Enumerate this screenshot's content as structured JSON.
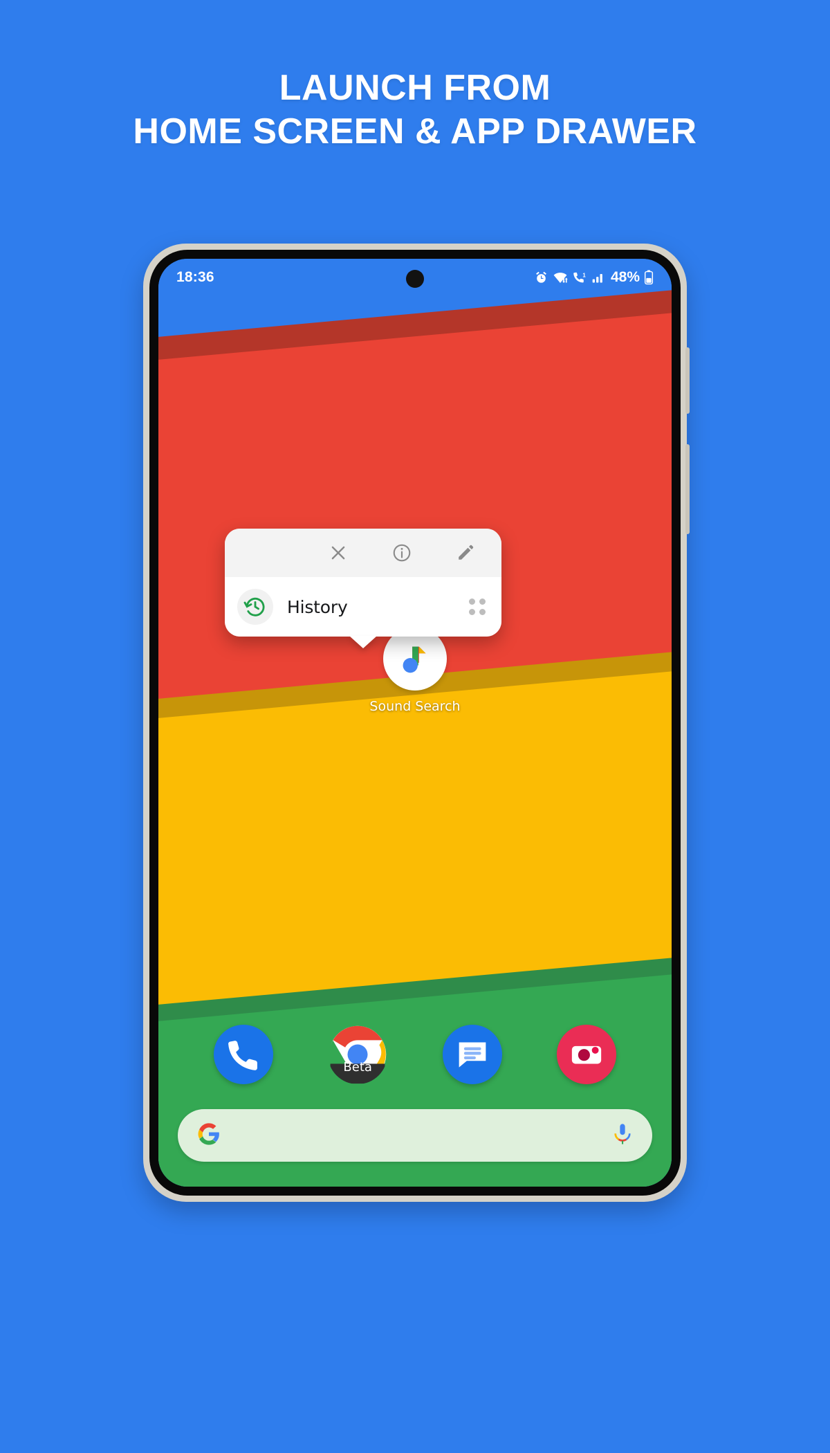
{
  "promo": {
    "line1": "LAUNCH FROM",
    "line2": "HOME SCREEN & APP DRAWER",
    "background_color": "#2f7ded",
    "text_color": "#ffffff"
  },
  "phone": {
    "status_bar": {
      "time": "18:36",
      "battery_percent": "48%",
      "icons": [
        "alarm-icon",
        "wifi-icon",
        "call-forward-icon",
        "signal-icon",
        "battery-icon"
      ]
    },
    "popup": {
      "header_icons": [
        "close-icon",
        "info-icon",
        "edit-icon"
      ],
      "shortcut": {
        "label": "History",
        "icon": "history-icon",
        "icon_color": "#34a853",
        "handle": "drag-handle-icon"
      }
    },
    "app_shortcut": {
      "label": "Sound Search",
      "icon": "sound-search-icon"
    },
    "dock": [
      {
        "name": "phone",
        "label": "",
        "icon": "phone-icon",
        "color": "#1a73e8"
      },
      {
        "name": "chrome-beta",
        "label": "Beta",
        "icon": "chrome-icon",
        "color": "#ea4335"
      },
      {
        "name": "messages",
        "label": "",
        "icon": "messages-icon",
        "color": "#1a73e8"
      },
      {
        "name": "camera",
        "label": "",
        "icon": "camera-icon",
        "color": "#ea2d55"
      }
    ],
    "search_bar": {
      "placeholder": "",
      "value": "",
      "left_icon": "google-g-icon",
      "right_icon": "microphone-icon",
      "background_color": "#dff0dc"
    },
    "wallpaper": {
      "colors": [
        "#2f7ded",
        "#ea4335",
        "#fbbc04",
        "#34a853"
      ]
    }
  }
}
